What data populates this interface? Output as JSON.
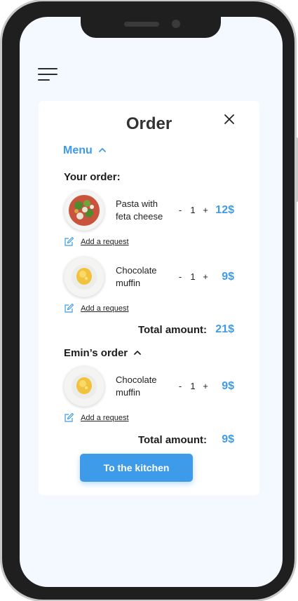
{
  "order": {
    "title": "Order",
    "menu_label": "Menu",
    "your_order_label": "Your order:",
    "your_items": [
      {
        "name_line1": "Pasta with",
        "name_line2": "feta cheese",
        "minus": "-",
        "qty": "1",
        "plus": "+",
        "price": "12$",
        "request_label": "Add a request",
        "image": "pasta-salad"
      },
      {
        "name_line1": "Chocolate",
        "name_line2": "muffin",
        "minus": "-",
        "qty": "1",
        "plus": "+",
        "price": "9$",
        "request_label": "Add a request",
        "image": "muffin"
      }
    ],
    "your_total_label": "Total amount:",
    "your_total_value": "21$",
    "other_order_label": "Emin’s order",
    "other_items": [
      {
        "name_line1": "Chocolate",
        "name_line2": "muffin",
        "minus": "-",
        "qty": "1",
        "plus": "+",
        "price": "9$",
        "request_label": "Add a request",
        "image": "muffin"
      }
    ],
    "other_total_label": "Total amount:",
    "other_total_value": "9$",
    "submit_label": "To the kitchen"
  },
  "colors": {
    "accent": "#3d9be9",
    "background": "#f3f9ff",
    "card": "#ffffff",
    "frame": "#1f1f1f"
  },
  "icons": [
    "menu-icon",
    "close-icon",
    "chevron-up-icon",
    "edit-icon"
  ]
}
